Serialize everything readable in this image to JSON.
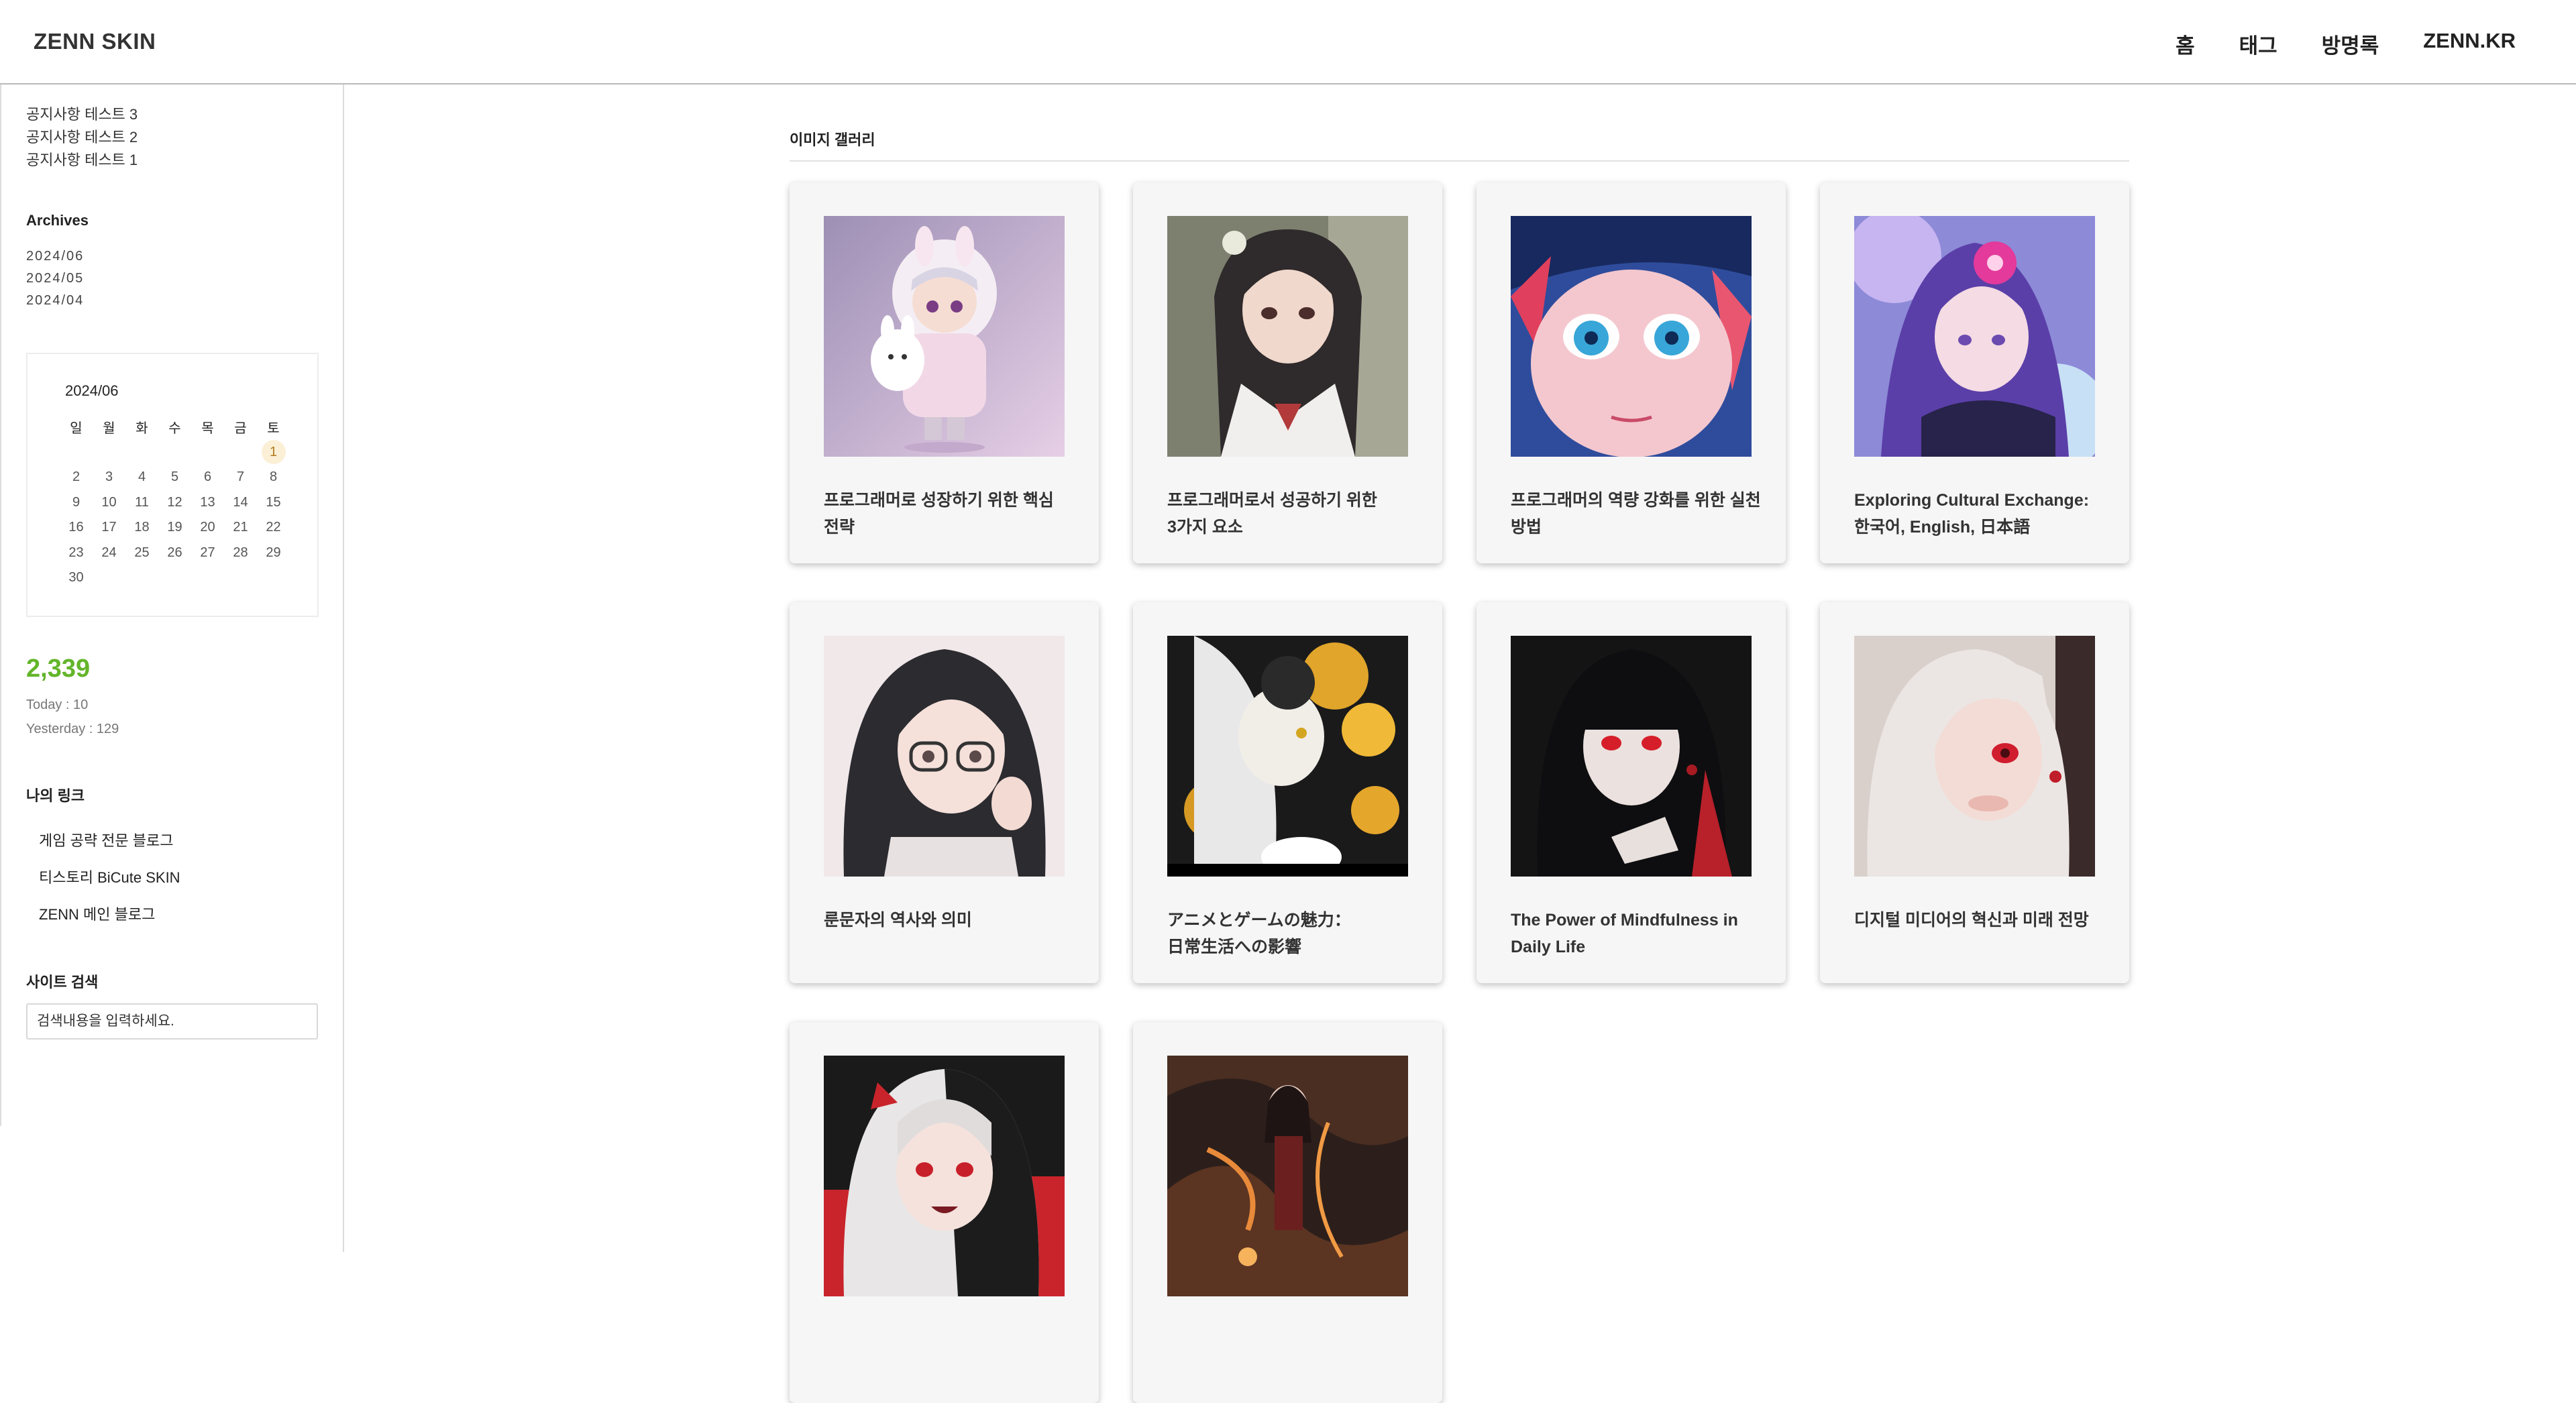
{
  "header": {
    "logo": "ZENN SKIN",
    "nav": [
      {
        "label": "홈"
      },
      {
        "label": "태그"
      },
      {
        "label": "방명록"
      },
      {
        "label": "ZENN.KR"
      }
    ]
  },
  "sidebar": {
    "notices": [
      "공지사항 테스트 3",
      "공지사항 테스트 2",
      "공지사항 테스트 1"
    ],
    "archives_title": "Archives",
    "archives": [
      "2024/06",
      "2024/05",
      "2024/04"
    ],
    "calendar": {
      "title": "2024/06",
      "weekdays": [
        "일",
        "월",
        "화",
        "수",
        "목",
        "금",
        "토"
      ],
      "weeks": [
        [
          "",
          "",
          "",
          "",
          "",
          "",
          "1"
        ],
        [
          "2",
          "3",
          "4",
          "5",
          "6",
          "7",
          "8"
        ],
        [
          "9",
          "10",
          "11",
          "12",
          "13",
          "14",
          "15"
        ],
        [
          "16",
          "17",
          "18",
          "19",
          "20",
          "21",
          "22"
        ],
        [
          "23",
          "24",
          "25",
          "26",
          "27",
          "28",
          "29"
        ],
        [
          "30",
          "",
          "",
          "",
          "",
          "",
          ""
        ]
      ],
      "highlighted_day": "1"
    },
    "counter": {
      "total": "2,339",
      "today": "Today : 10",
      "yesterday": "Yesterday : 129",
      "total_color": "#63b52a"
    },
    "links_title": "나의 링크",
    "links": [
      "게임 공략 전문 블로그",
      "티스토리 BiCute SKIN",
      "ZENN 메인 블로그"
    ],
    "search_title": "사이트 검색",
    "search_placeholder": "검색내용을 입력하세요."
  },
  "main": {
    "gallery_title": "이미지 갤러리",
    "cards": [
      {
        "title": "프로그래머로 성장하기 위한 핵심\n전략",
        "image": "chibi-girl-bunny-hoodie"
      },
      {
        "title": "프로그래머로서 성공하기 위한\n3가지 요소",
        "image": "girl-school-uniform"
      },
      {
        "title": "프로그래머의 역량 강화를 위한 실천\n방법",
        "image": "girl-blue-eyes-closeup"
      },
      {
        "title": "Exploring Cultural Exchange:\n한국어, English, 日本語",
        "image": "girl-purple-flowers"
      },
      {
        "title": "룬문자의 역사와 의미",
        "image": "girl-glasses"
      },
      {
        "title": "アニメとゲームの魅力：\n日常生活への影響",
        "image": "girl-yellow-flowers"
      },
      {
        "title": "The Power of Mindfulness in\nDaily Life",
        "image": "girl-red-eyes-dark"
      },
      {
        "title": "디지털 미디어의 혁신과 미래 전망",
        "image": "girl-white-hair-red-eye"
      },
      {
        "title": "",
        "image": "girl-red-black-hair"
      },
      {
        "title": "",
        "image": "girl-dragon-fire"
      }
    ]
  }
}
